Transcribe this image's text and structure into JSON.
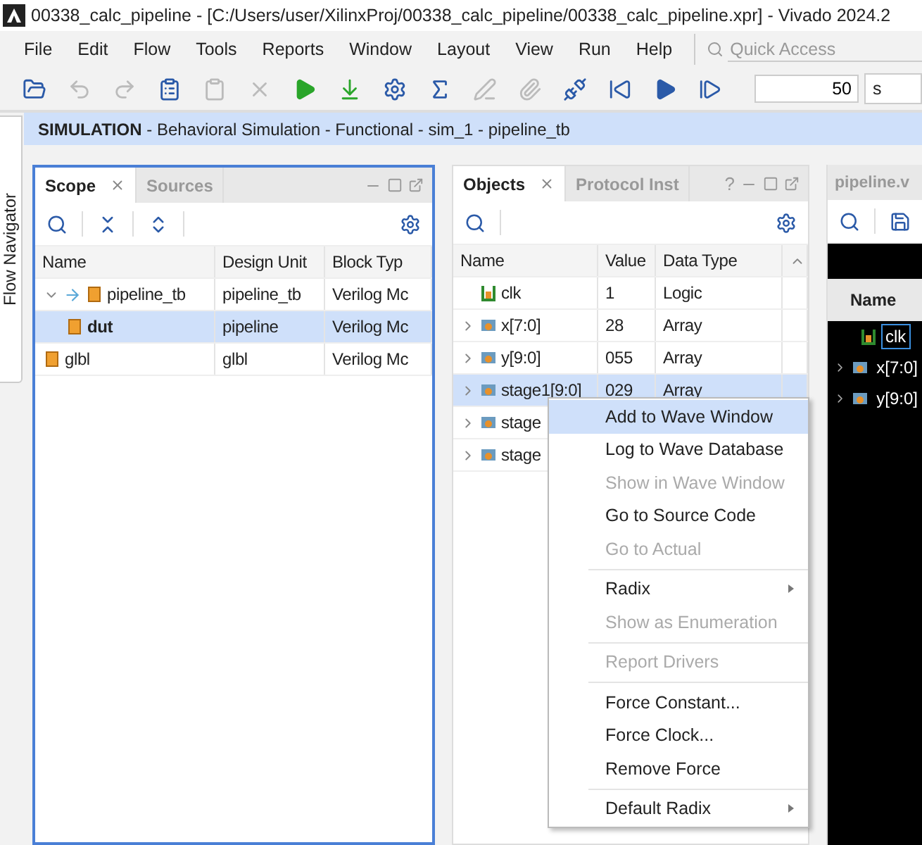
{
  "window": {
    "title": "00338_calc_pipeline - [C:/Users/user/XilinxProj/00338_calc_pipeline/00338_calc_pipeline.xpr] - Vivado 2024.2"
  },
  "menu": [
    "File",
    "Edit",
    "Flow",
    "Tools",
    "Reports",
    "Window",
    "Layout",
    "View",
    "Run",
    "Help"
  ],
  "quick_access": {
    "placeholder": "Quick Access"
  },
  "toolbar": [
    {
      "kind": "open",
      "disabled": false
    },
    {
      "kind": "undo",
      "disabled": true
    },
    {
      "kind": "redo",
      "disabled": true
    },
    {
      "kind": "copy",
      "disabled": false
    },
    {
      "kind": "paste",
      "disabled": true
    },
    {
      "kind": "delete",
      "disabled": true
    },
    {
      "kind": "run",
      "disabled": false
    },
    {
      "kind": "download",
      "disabled": false
    },
    {
      "kind": "settings",
      "disabled": false
    },
    {
      "kind": "sigma",
      "disabled": false
    },
    {
      "kind": "pen",
      "disabled": true
    },
    {
      "kind": "clip",
      "disabled": true
    },
    {
      "kind": "unplug",
      "disabled": false
    },
    {
      "kind": "restart",
      "disabled": false
    },
    {
      "kind": "play",
      "disabled": false
    },
    {
      "kind": "step",
      "disabled": false
    }
  ],
  "run_time": {
    "value": "50",
    "unit": "s"
  },
  "banner": {
    "title": "SIMULATION",
    "detail": " - Behavioral Simulation - Functional - sim_1 - pipeline_tb"
  },
  "flow_navigator": "Flow Navigator",
  "scope_panel": {
    "tabs": [
      {
        "label": "Scope",
        "selected": true
      },
      {
        "label": "Sources",
        "selected": false
      }
    ],
    "columns": [
      "Name",
      "Design Unit",
      "Block Typ"
    ],
    "rows": [
      {
        "name": "pipeline_tb",
        "unit": "pipeline_tb",
        "block": "Verilog Mc",
        "expanded": true,
        "selected": false,
        "children": [
          {
            "name": "dut",
            "unit": "pipeline",
            "block": "Verilog Mc",
            "selected": true
          }
        ]
      },
      {
        "name": "glbl",
        "unit": "glbl",
        "block": "Verilog Mc",
        "selected": false
      }
    ]
  },
  "objects_panel": {
    "tabs": [
      {
        "label": "Objects",
        "selected": true
      },
      {
        "label": "Protocol Inst",
        "selected": false
      }
    ],
    "help": "?",
    "columns": [
      "Name",
      "Value",
      "Data Type"
    ],
    "rows": [
      {
        "name": "clk",
        "value": "1",
        "type": "Logic",
        "kind": "logic",
        "selected": false
      },
      {
        "name": "x[7:0]",
        "value": "28",
        "type": "Array",
        "kind": "array",
        "selected": false
      },
      {
        "name": "y[9:0]",
        "value": "055",
        "type": "Array",
        "kind": "array",
        "selected": false
      },
      {
        "name": "stage1[9:0]",
        "value": "029",
        "type": "Array",
        "kind": "array",
        "selected": true
      },
      {
        "name": "stage",
        "kind": "array",
        "selected": false
      },
      {
        "name": "stage",
        "kind": "array",
        "selected": false
      }
    ]
  },
  "wave_panel": {
    "tab": "pipeline.v",
    "column": "Name",
    "rows": [
      {
        "name": "clk",
        "kind": "logic",
        "selected": true
      },
      {
        "name": "x[7:0]",
        "kind": "array",
        "selected": false
      },
      {
        "name": "y[9:0]",
        "kind": "array",
        "selected": false
      }
    ]
  },
  "context_menu": [
    {
      "kind": "item",
      "label": "Add to Wave Window",
      "disabled": false,
      "selected": true
    },
    {
      "kind": "item",
      "label": "Log to Wave Database",
      "disabled": false,
      "selected": false
    },
    {
      "kind": "item",
      "label": "Show in Wave Window",
      "disabled": true,
      "selected": false
    },
    {
      "kind": "item",
      "label": "Go to Source Code",
      "disabled": false,
      "selected": false
    },
    {
      "kind": "item",
      "label": "Go to Actual",
      "disabled": true,
      "selected": false
    },
    {
      "kind": "separator"
    },
    {
      "kind": "submenu",
      "label": "Radix",
      "disabled": false,
      "selected": false
    },
    {
      "kind": "item",
      "label": "Show as Enumeration",
      "disabled": true,
      "selected": false
    },
    {
      "kind": "separator"
    },
    {
      "kind": "item",
      "label": "Report Drivers",
      "disabled": true,
      "selected": false
    },
    {
      "kind": "separator"
    },
    {
      "kind": "item",
      "label": "Force Constant...",
      "disabled": false,
      "selected": false
    },
    {
      "kind": "item",
      "label": "Force Clock...",
      "disabled": false,
      "selected": false
    },
    {
      "kind": "item",
      "label": "Remove Force",
      "disabled": false,
      "selected": false
    },
    {
      "kind": "separator"
    },
    {
      "kind": "submenu",
      "label": "Default Radix",
      "disabled": false,
      "selected": false
    }
  ]
}
